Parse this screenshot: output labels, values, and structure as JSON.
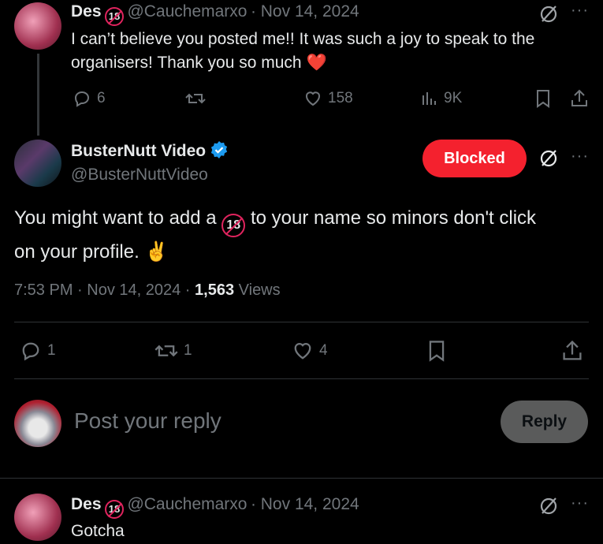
{
  "post1": {
    "name": "Des",
    "handle": "@Cauchemarxo",
    "date": "· Nov 14, 2024",
    "text_line1": "I can’t believe you posted me!! It was such a joy to speak to the",
    "text_line2": "organisers! Thank you so much",
    "heart_emoji": "❤️",
    "replies": "6",
    "likes": "158",
    "views": "9K"
  },
  "main_post": {
    "name": "BusterNutt Video",
    "handle": "@BusterNuttVideo",
    "blocked_label": "Blocked",
    "text_part1": "You might want to add a",
    "text_part2": "to your name so minors don't click",
    "text_line2": "on your profile.",
    "emoji": "✌️",
    "timestamp": "7:53 PM · Nov 14, 2024 ·",
    "views_count": "1,563",
    "views_label": "Views",
    "replies": "1",
    "reposts": "1",
    "likes": "4"
  },
  "reply_composer": {
    "placeholder": "Post your reply",
    "reply_label": "Reply"
  },
  "post3": {
    "name": "Des",
    "handle": "@Cauchemarxo",
    "date": "· Nov 14, 2024",
    "text": "Gotcha"
  },
  "badge18": "18",
  "more": "···",
  "colors": {
    "blocked": "#f4212e",
    "verified": "#1d9bf0",
    "bg": "#000000"
  }
}
